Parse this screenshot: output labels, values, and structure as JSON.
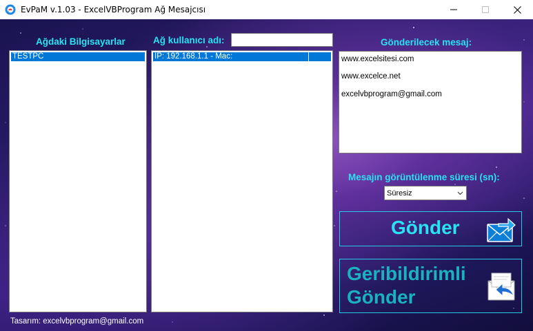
{
  "window": {
    "title": "EvPaM v.1.03 - ExcelVBProgram Ağ Mesajcısı",
    "minimize_icon": "minimize-icon",
    "maximize_icon": "maximize-icon",
    "close_icon": "close-icon"
  },
  "computers": {
    "header": "Ağdaki Bilgisayarlar",
    "items": [
      "TESTPC"
    ]
  },
  "network": {
    "label": "Ağ kullanıcı adı:",
    "username_value": "",
    "items": [
      "IP: 192.168.1.1  -  Mac:"
    ]
  },
  "message": {
    "header": "Gönderilecek mesaj:",
    "lines": [
      "www.excelsitesi.com",
      "www.excelce.net",
      "excelvbprogram@gmail.com"
    ]
  },
  "duration": {
    "label": "Mesajın görüntülenme süresi (sn):",
    "selected": "Süresiz"
  },
  "buttons": {
    "send": "Gönder",
    "send_feedback_line1": "Geribildirimli",
    "send_feedback_line2": "Gönder"
  },
  "footer": "Tasarım: excelvbprogram@gmail.com",
  "colors": {
    "accent": "#29e3f2",
    "selection": "#0078d7"
  }
}
